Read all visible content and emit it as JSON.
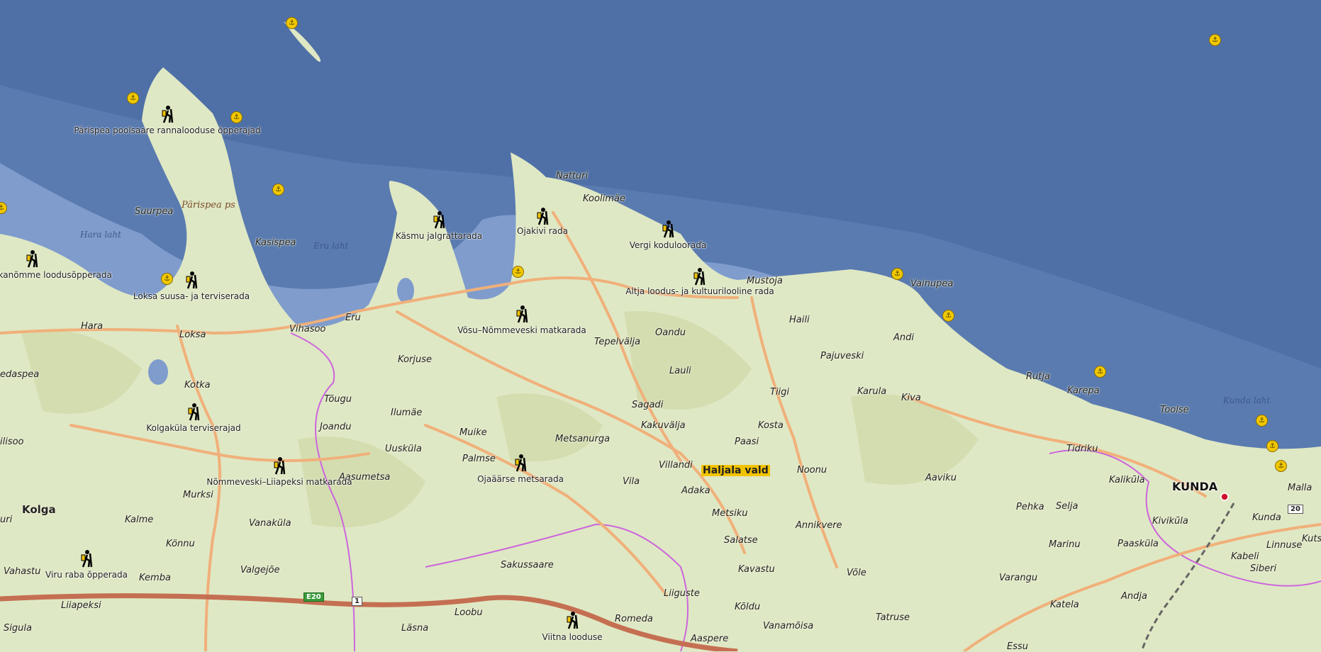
{
  "map": {
    "region_label": "Haljala vald",
    "town_major": "KUNDA",
    "water_labels": [
      "Hara laht",
      "Eru laht",
      "Kunda laht"
    ],
    "peninsula_label": "Pärispea ps",
    "road_shields": {
      "e20": "E20",
      "r1": "1",
      "r20": "20"
    },
    "colors": {
      "sea_deep": "#5a7bb0",
      "sea_shallow": "#8aa6d4",
      "land": "#dfe8c4",
      "road": "#f0b07a",
      "highway": "#c56f52",
      "boundary": "#cc66dd"
    }
  },
  "places": [
    "Natturi",
    "Koolimäe",
    "Suurpea",
    "Kasispea",
    "Hara",
    "Loksa",
    "Vihasoo",
    "Eru",
    "Mustoja",
    "Vainupea",
    "Haili",
    "Andi",
    "Oandu",
    "Tepelvälja",
    "Korjuse",
    "Lauli",
    "Pajuveski",
    "Kotka",
    "Tõugu",
    "Ilumäe",
    "Sagadi",
    "Tiigi",
    "Karula",
    "Rutja",
    "Karepa",
    "Joandu",
    "Uusküla",
    "Muike",
    "Kakuvälja",
    "Kosta",
    "Kiva",
    "Toolse",
    "Palmse",
    "Metsanurga",
    "Paasi",
    "Tidriku",
    "Aasumetsa",
    "Villandi",
    "Vila",
    "Noonu",
    "Aaviku",
    "Kalikūla",
    "Kolga",
    "Murksi",
    "Adaka",
    "Pehka",
    "Selja",
    "Kalme",
    "Vanaküla",
    "Metsiku",
    "Annikvere",
    "Kunda",
    "Könnu",
    "Salatse",
    "Marinu",
    "Paasküla",
    "Linnuse",
    "Kavastu",
    "Varangu",
    "Kabeli",
    "Vahastu",
    "Kemba",
    "Valgejõe",
    "Sakussaare",
    "Võle",
    "Siberi",
    "Liiguste",
    "Andja",
    "Liiapeksi",
    "Loobu",
    "Kõldu",
    "Katela",
    "Romeda",
    "Tatruse",
    "Sigula",
    "Läsna",
    "Aaspere",
    "Vanamõisa",
    "Essu",
    "Kivikūla",
    "Malla",
    "Kuts",
    "edaspea",
    "ilisoo",
    "uri"
  ],
  "trails": [
    "Pärispea poolsaare rannalooduse õpperajad",
    "Käsmu jalgrattarada",
    "Ojakivi rada",
    "Vergi kodulooraďa",
    "Altja loodus- ja kultuurilooline rada",
    "Majakivi–Pikanõmme loodusõpperada",
    "Loksa suusa- ja terviserada",
    "Võsu–Nõmmeveski matkarada",
    "Kolgaküla terviserajad",
    "Nõmmeveski–Liiapeksi matkarada",
    "Ojaäärse metsarada",
    "Viru raba õpperada",
    "Viitna looduse"
  ]
}
